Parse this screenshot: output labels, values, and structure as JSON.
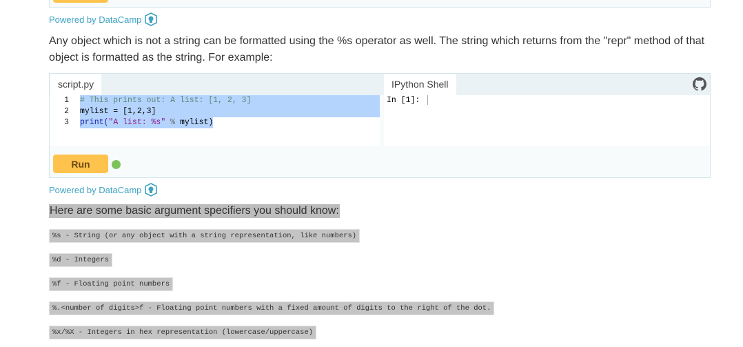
{
  "powered_by": "Powered by DataCamp",
  "paragraph": "Any object which is not a string can be formatted using the %s operator as well. The string which returns from the \"repr\" method of that object is formatted as the string. For example:",
  "widget": {
    "script_tab": "script.py",
    "shell_tab": "IPython Shell",
    "line_numbers": [
      "1",
      "2",
      "3"
    ],
    "code": {
      "l1": "# This prints out: A list: [1, 2, 3]",
      "l2": "mylist = [1,2,3]",
      "l3_fn": "print(",
      "l3_str": "\"A list: %s\"",
      "l3_op": " % ",
      "l3_rest": "mylist)"
    },
    "shell_prompt": "In [1]:",
    "run_label": "Run",
    "status_color": "#7dc35b"
  },
  "heading": "Here are some basic argument specifiers you should know:",
  "specifiers": [
    "%s - String (or any object with a string representation, like numbers)",
    "%d - Integers",
    "%f - Floating point numbers",
    "%.<number of digits>f - Floating point numbers with a fixed amount of digits to the right of the dot.",
    "%x/%X - Integers in hex representation (lowercase/uppercase)"
  ]
}
